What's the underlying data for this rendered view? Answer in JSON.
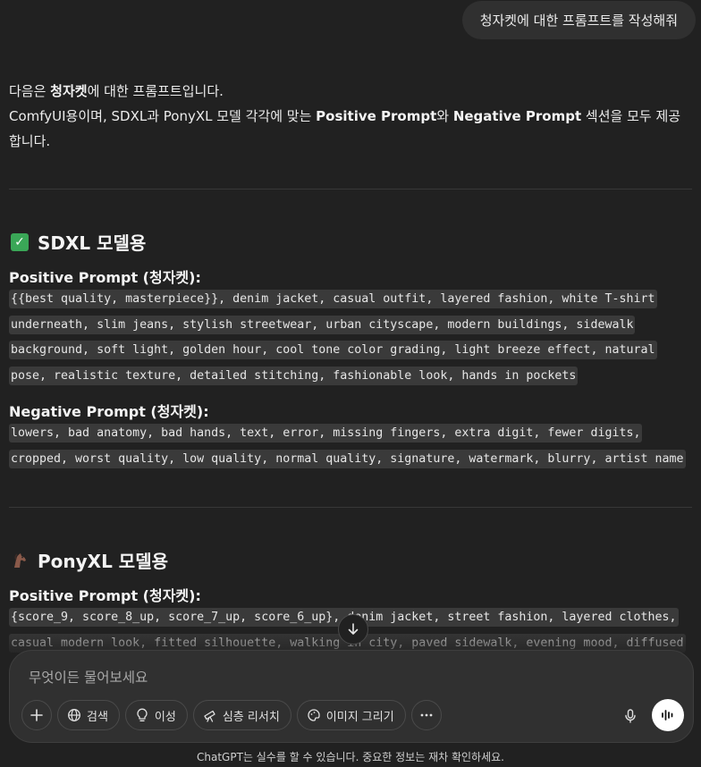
{
  "user_message": "청자켓에 대한 프롬프트를 작성해줘",
  "intro": {
    "line1_pre": "다음은 ",
    "line1_bold": "청자켓",
    "line1_post": "에 대한 프롬프트입니다.",
    "line2_pre": "ComfyUI용이며, SDXL과 PonyXL 모델 각각에 맞는 ",
    "line2_bold1": "Positive Prompt",
    "line2_mid": "와 ",
    "line2_bold2": "Negative Prompt",
    "line2_post": " 섹션을 모두 제공",
    "line3": "합니다."
  },
  "sections": [
    {
      "icon": "check-emoji-icon",
      "title": "SDXL 모델용",
      "positive_label": "Positive Prompt (청자켓):",
      "positive": "{{best quality, masterpiece}}, denim jacket, casual outfit, layered fashion, white T-shirt underneath, slim jeans, stylish streetwear, urban cityscape, modern buildings, sidewalk background, soft light, golden hour, cool tone color grading, light breeze effect, natural pose, realistic texture, detailed stitching, fashionable look, hands in pockets",
      "negative_label": "Negative Prompt (청자켓):",
      "negative": "lowers, bad anatomy, bad hands, text, error, missing fingers, extra digit, fewer digits, cropped, worst quality, low quality, normal quality, signature, watermark, blurry, artist name"
    },
    {
      "icon": "horse-emoji-icon",
      "title": "PonyXL 모델용",
      "positive_label": "Positive Prompt (청자켓):",
      "positive": "{score_9, score_8_up, score_7_up, score_6_up}, denim jacket, street fashion, layered clothes, casual modern look, fitted silhouette, walking in city, paved sidewalk, evening mood, diffused"
    }
  ],
  "composer": {
    "placeholder": "무엇이든 물어보세요",
    "tools": [
      "검색",
      "이성",
      "심층 리서치",
      "이미지 그리기"
    ]
  },
  "footer": "ChatGPT는 실수를 할 수 있습니다. 중요한 정보는 재차 확인하세요."
}
